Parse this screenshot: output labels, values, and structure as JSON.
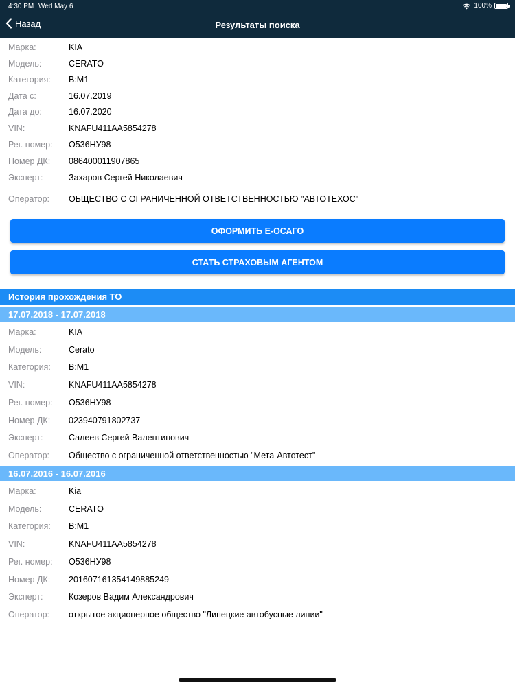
{
  "status_bar": {
    "time": "4:30 PM",
    "date": "Wed May 6",
    "battery": "100%"
  },
  "nav": {
    "back_label": "Назад",
    "title": "Результаты поиска"
  },
  "current": [
    {
      "label": "Марка:",
      "value": "KIA"
    },
    {
      "label": "Модель:",
      "value": "CERATO"
    },
    {
      "label": "Категория:",
      "value": "B:M1"
    },
    {
      "label": "Дата с:",
      "value": "16.07.2019"
    },
    {
      "label": "Дата до:",
      "value": "16.07.2020"
    },
    {
      "label": "VIN:",
      "value": "KNAFU411AA5854278"
    },
    {
      "label": "Рег. номер:",
      "value": "О536НУ98"
    },
    {
      "label": "Номер ДК:",
      "value": "086400011907865"
    },
    {
      "label": "Эксперт:",
      "value": "Захаров Сергей Николаевич"
    },
    {
      "label": "Оператор:",
      "value": "ОБЩЕСТВО С ОГРАНИЧЕННОЙ ОТВЕТСТВЕННОСТЬЮ \"АВТОТЕХОС\""
    }
  ],
  "buttons": {
    "eosago": "ОФОРМИТЬ Е-ОСАГО",
    "agent": "СТАТЬ СТРАХОВЫМ АГЕНТОМ"
  },
  "history": {
    "title": "История прохождения ТО",
    "entries": [
      {
        "period": "17.07.2018 - 17.07.2018",
        "fields": [
          {
            "label": "Марка:",
            "value": "KIA"
          },
          {
            "label": "Модель:",
            "value": "Cerato"
          },
          {
            "label": "Категория:",
            "value": "B:M1"
          },
          {
            "label": "VIN:",
            "value": "KNAFU411AA5854278"
          },
          {
            "label": "Рег. номер:",
            "value": "О536НУ98"
          },
          {
            "label": "Номер ДК:",
            "value": "023940791802737"
          },
          {
            "label": "Эксперт:",
            "value": "Салеев Сергей Валентинович"
          },
          {
            "label": "Оператор:",
            "value": "Общество с ограниченной ответственностью \"Мета-Автотест\""
          }
        ]
      },
      {
        "period": "16.07.2016 - 16.07.2016",
        "fields": [
          {
            "label": "Марка:",
            "value": "Kia"
          },
          {
            "label": "Модель:",
            "value": "CERATO"
          },
          {
            "label": "Категория:",
            "value": "B:M1"
          },
          {
            "label": "VIN:",
            "value": "KNAFU411AA5854278"
          },
          {
            "label": "Рег. номер:",
            "value": "О536НУ98"
          },
          {
            "label": "Номер ДК:",
            "value": "20160716135414988524​9"
          },
          {
            "label": "Эксперт:",
            "value": "Козеров Вадим Александрович"
          },
          {
            "label": "Оператор:",
            "value": "открытое акционерное общество \"Липецкие автобусные линии\""
          }
        ]
      }
    ]
  }
}
